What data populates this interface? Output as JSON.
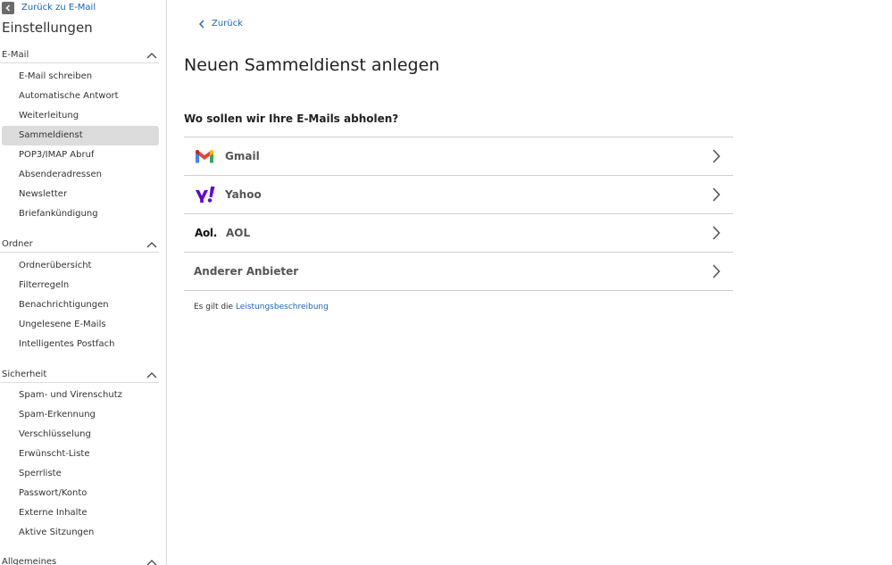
{
  "sidebar": {
    "back_label": "Zurück zu E-Mail",
    "title": "Einstellungen",
    "sections": [
      {
        "label": "E-Mail",
        "items": [
          "E-Mail schreiben",
          "Automatische Antwort",
          "Weiterleitung",
          "Sammeldienst",
          "POP3/IMAP Abruf",
          "Absenderadressen",
          "Newsletter",
          "Briefankündigung"
        ]
      },
      {
        "label": "Ordner",
        "items": [
          "Ordnerübersicht",
          "Filterregeln",
          "Benachrichtigungen",
          "Ungelesene E-Mails",
          "Intelligentes Postfach"
        ]
      },
      {
        "label": "Sicherheit",
        "items": [
          "Spam- und Virenschutz",
          "Spam-Erkennung",
          "Verschlüsselung",
          "Erwünscht-Liste",
          "Sperrliste",
          "Passwort/Konto",
          "Externe Inhalte",
          "Aktive Sitzungen"
        ]
      },
      {
        "label": "Allgemeines",
        "items": []
      }
    ],
    "active_item": "Sammeldienst"
  },
  "main": {
    "back_label": "Zurück",
    "title": "Neuen Sammeldienst anlegen",
    "question": "Wo sollen wir Ihre E-Mails abholen?",
    "providers": [
      {
        "label": "Gmail",
        "logo": "gmail-logo"
      },
      {
        "label": "Yahoo",
        "logo": "yahoo-logo"
      },
      {
        "label": "AOL",
        "logo": "aol-logo",
        "logo_text": "Aol."
      },
      {
        "label": "Anderer Anbieter",
        "logo": ""
      }
    ],
    "footer_prefix": "Es gilt die ",
    "footer_link": "Leistungsbeschreibung"
  },
  "colors": {
    "link": "#1a64b4",
    "active_bg": "#dcdcdc",
    "yahoo_purple": "#6001d2"
  }
}
